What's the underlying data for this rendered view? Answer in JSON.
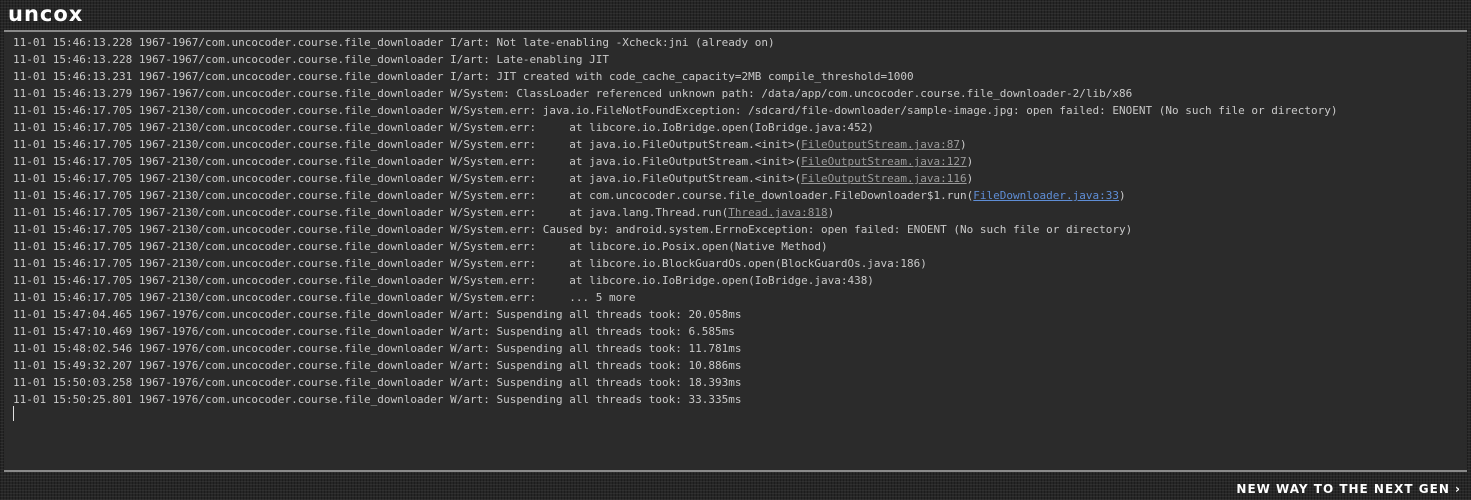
{
  "header": {
    "logo": "uncox"
  },
  "footer": {
    "tagline": "NEW WAY TO THE NEXT GEN ›"
  },
  "log": {
    "lines": [
      {
        "text": "11-01 15:46:13.228 1967-1967/com.uncocoder.course.file_downloader I/art: Not late-enabling -Xcheck:jni (already on)"
      },
      {
        "text": "11-01 15:46:13.228 1967-1967/com.uncocoder.course.file_downloader I/art: Late-enabling JIT"
      },
      {
        "text": "11-01 15:46:13.231 1967-1967/com.uncocoder.course.file_downloader I/art: JIT created with code_cache_capacity=2MB compile_threshold=1000"
      },
      {
        "text": "11-01 15:46:13.279 1967-1967/com.uncocoder.course.file_downloader W/System: ClassLoader referenced unknown path: /data/app/com.uncocoder.course.file_downloader-2/lib/x86"
      },
      {
        "text": "11-01 15:46:17.705 1967-2130/com.uncocoder.course.file_downloader W/System.err: java.io.FileNotFoundException: /sdcard/file-downloader/sample-image.jpg: open failed: ENOENT (No such file or directory)"
      },
      {
        "text": "11-01 15:46:17.705 1967-2130/com.uncocoder.course.file_downloader W/System.err:     at libcore.io.IoBridge.open(IoBridge.java:452)"
      },
      {
        "text": "11-01 15:46:17.705 1967-2130/com.uncocoder.course.file_downloader W/System.err:     at java.io.FileOutputStream.<init>(",
        "link": "FileOutputStream.java:87",
        "link_style": "grey",
        "after": ")"
      },
      {
        "text": "11-01 15:46:17.705 1967-2130/com.uncocoder.course.file_downloader W/System.err:     at java.io.FileOutputStream.<init>(",
        "link": "FileOutputStream.java:127",
        "link_style": "grey",
        "after": ")"
      },
      {
        "text": "11-01 15:46:17.705 1967-2130/com.uncocoder.course.file_downloader W/System.err:     at java.io.FileOutputStream.<init>(",
        "link": "FileOutputStream.java:116",
        "link_style": "grey",
        "after": ")"
      },
      {
        "text": "11-01 15:46:17.705 1967-2130/com.uncocoder.course.file_downloader W/System.err:     at com.uncocoder.course.file_downloader.FileDownloader$1.run(",
        "link": "FileDownloader.java:33",
        "link_style": "blue",
        "after": ")"
      },
      {
        "text": "11-01 15:46:17.705 1967-2130/com.uncocoder.course.file_downloader W/System.err:     at java.lang.Thread.run(",
        "link": "Thread.java:818",
        "link_style": "grey",
        "after": ")"
      },
      {
        "text": "11-01 15:46:17.705 1967-2130/com.uncocoder.course.file_downloader W/System.err: Caused by: android.system.ErrnoException: open failed: ENOENT (No such file or directory)"
      },
      {
        "text": "11-01 15:46:17.705 1967-2130/com.uncocoder.course.file_downloader W/System.err:     at libcore.io.Posix.open(Native Method)"
      },
      {
        "text": "11-01 15:46:17.705 1967-2130/com.uncocoder.course.file_downloader W/System.err:     at libcore.io.BlockGuardOs.open(BlockGuardOs.java:186)"
      },
      {
        "text": "11-01 15:46:17.705 1967-2130/com.uncocoder.course.file_downloader W/System.err:     at libcore.io.IoBridge.open(IoBridge.java:438)"
      },
      {
        "text": "11-01 15:46:17.705 1967-2130/com.uncocoder.course.file_downloader W/System.err:     ... 5 more"
      },
      {
        "text": "11-01 15:47:04.465 1967-1976/com.uncocoder.course.file_downloader W/art: Suspending all threads took: 20.058ms"
      },
      {
        "text": "11-01 15:47:10.469 1967-1976/com.uncocoder.course.file_downloader W/art: Suspending all threads took: 6.585ms"
      },
      {
        "text": "11-01 15:48:02.546 1967-1976/com.uncocoder.course.file_downloader W/art: Suspending all threads took: 11.781ms"
      },
      {
        "text": "11-01 15:49:32.207 1967-1976/com.uncocoder.course.file_downloader W/art: Suspending all threads took: 10.886ms"
      },
      {
        "text": "11-01 15:50:03.258 1967-1976/com.uncocoder.course.file_downloader W/art: Suspending all threads took: 18.393ms"
      },
      {
        "text": "11-01 15:50:25.801 1967-1976/com.uncocoder.course.file_downloader W/art: Suspending all threads took: 33.335ms"
      }
    ]
  }
}
